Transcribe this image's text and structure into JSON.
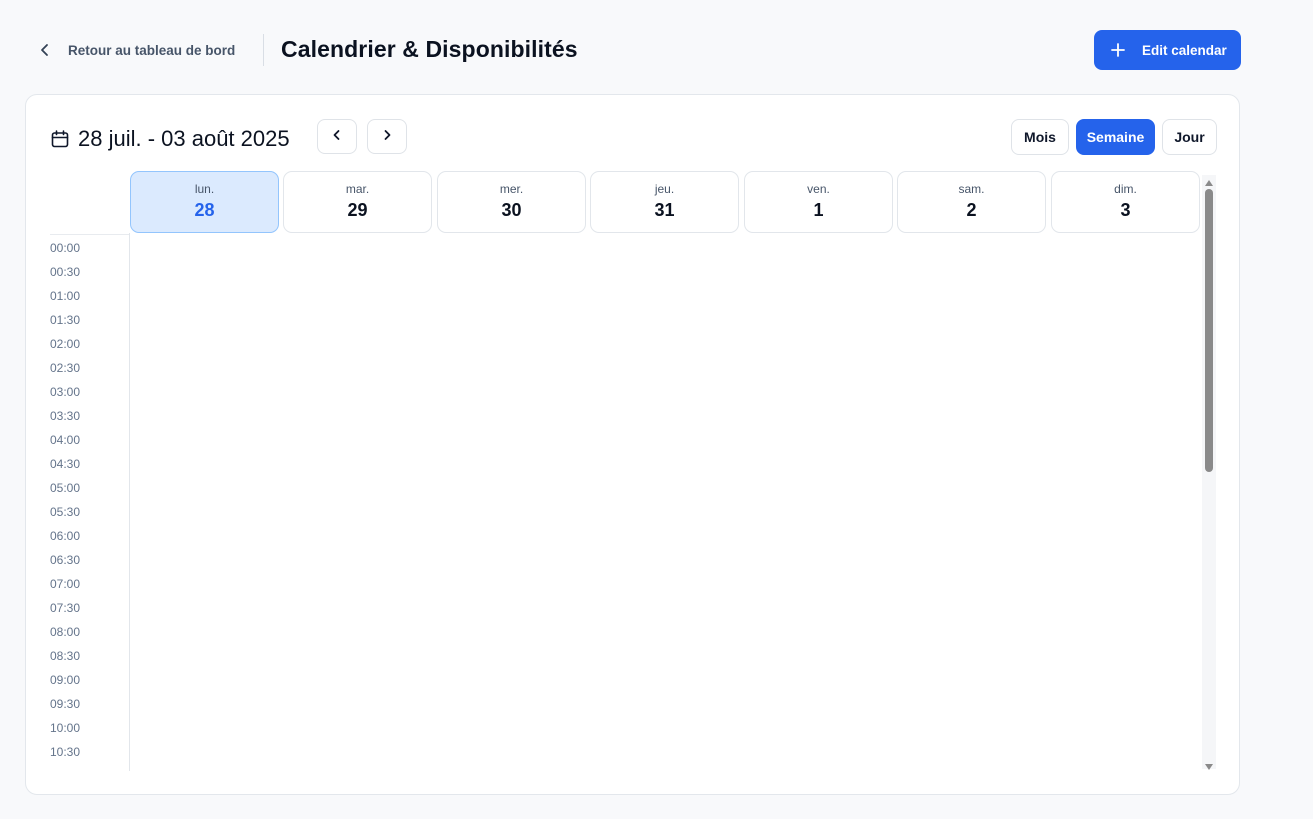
{
  "header": {
    "back_label": "Retour au tableau de bord",
    "title": "Calendrier & Disponibilités",
    "edit_label": "Edit calendar"
  },
  "calendar": {
    "range_label": "28 juil. - 03 août 2025",
    "views": {
      "month": "Mois",
      "week": "Semaine",
      "day": "Jour",
      "active": "Semaine"
    },
    "days": [
      {
        "name": "lun.",
        "date": "28",
        "today": true
      },
      {
        "name": "mar.",
        "date": "29",
        "today": false
      },
      {
        "name": "mer.",
        "date": "30",
        "today": false
      },
      {
        "name": "jeu.",
        "date": "31",
        "today": false
      },
      {
        "name": "ven.",
        "date": "1",
        "today": false
      },
      {
        "name": "sam.",
        "date": "2",
        "today": false
      },
      {
        "name": "dim.",
        "date": "3",
        "today": false
      }
    ],
    "time_slots": [
      "00:00",
      "00:30",
      "01:00",
      "01:30",
      "02:00",
      "02:30",
      "03:00",
      "03:30",
      "04:00",
      "04:30",
      "05:00",
      "05:30",
      "06:00",
      "06:30",
      "07:00",
      "07:30",
      "08:00",
      "08:30",
      "09:00",
      "09:30",
      "10:00",
      "10:30"
    ]
  },
  "colors": {
    "accent": "#2563eb",
    "today_bg": "#dbeafe",
    "today_border": "#93c5fd"
  },
  "icons": {
    "back": "chevron-left-icon",
    "edit": "plus-icon",
    "range": "calendar-icon",
    "prev": "chevron-left-icon",
    "next": "chevron-right-icon"
  }
}
